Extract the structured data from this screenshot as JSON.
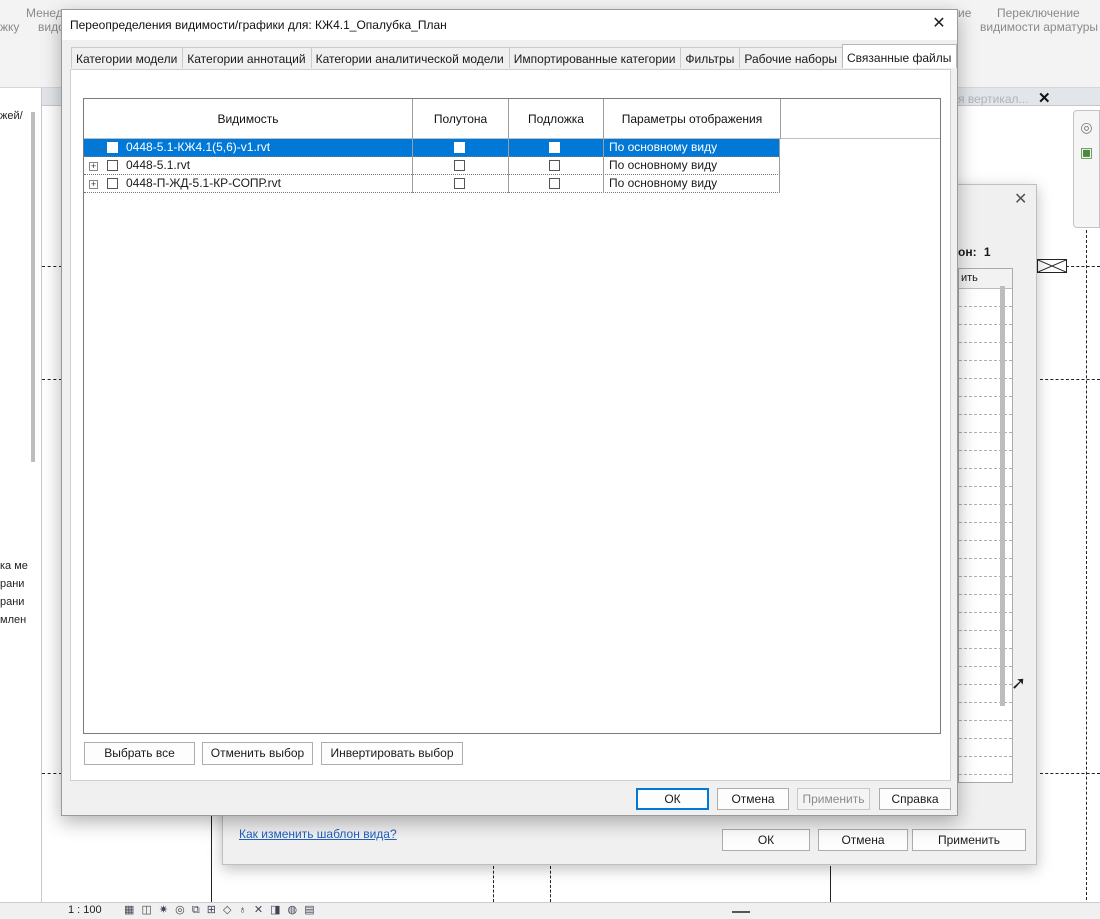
{
  "background": {
    "ribbon_left": "Менед",
    "ribbon_left2": "видо",
    "ribbon_left3": "жку",
    "ribbon_right_1": "Переключение",
    "ribbon_right_2": "видимости арматуры",
    "ribbon_right_3": "ие",
    "view_tab_title": "я вертикал...",
    "left_panel_items": [
      "жей/",
      "ка ме",
      "рани",
      "рани",
      "млен"
    ],
    "scale": "1 : 100"
  },
  "secondary_dialog": {
    "count_label": "он:",
    "count_value": "1",
    "list_header": "ить",
    "help_link": "Как изменить шаблон вида?",
    "ok_label": "ОК",
    "cancel_label": "Отмена",
    "apply_label": "Применить"
  },
  "dialog": {
    "title": "Переопределения видимости/графики для: КЖ4.1_Опалубка_План",
    "tabs": [
      {
        "label": "Категории модели"
      },
      {
        "label": "Категории аннотаций"
      },
      {
        "label": "Категории аналитической модели"
      },
      {
        "label": "Импортированные категории"
      },
      {
        "label": "Фильтры"
      },
      {
        "label": "Рабочие наборы"
      },
      {
        "label": "Связанные файлы"
      }
    ],
    "active_tab": "Связанные файлы",
    "table": {
      "columns": [
        "Видимость",
        "Полутона",
        "Подложка",
        "Параметры отображения"
      ],
      "rows": [
        {
          "name": "0448-5.1-КЖ4.1(5,6)-v1.rvt",
          "visible": false,
          "halftone": false,
          "underlay": false,
          "display": "По основному виду",
          "selected": true,
          "expandable": false
        },
        {
          "name": "0448-5.1.rvt",
          "visible": false,
          "halftone": false,
          "underlay": false,
          "display": "По основному виду",
          "selected": false,
          "expandable": true
        },
        {
          "name": "0448-П-ЖД-5.1-КР-СОПР.rvt",
          "visible": false,
          "halftone": false,
          "underlay": false,
          "display": "По основному виду",
          "selected": false,
          "expandable": true
        }
      ]
    },
    "panel_buttons": {
      "select_all": "Выбрать все",
      "select_none": "Отменить выбор",
      "invert": "Инвертировать выбор"
    },
    "footer_buttons": {
      "ok": "ОК",
      "cancel": "Отмена",
      "apply": "Применить",
      "help": "Справка"
    }
  },
  "colors": {
    "selection": "#0078d7",
    "link": "#1f5fbf"
  }
}
